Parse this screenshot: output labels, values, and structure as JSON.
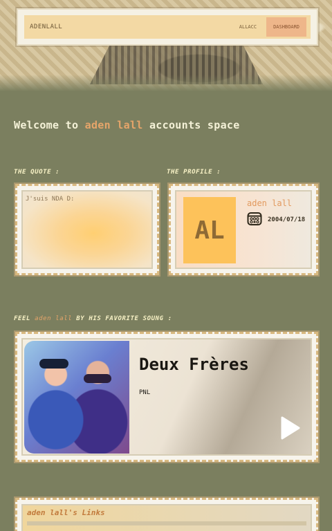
{
  "nav": {
    "brand": "ADENLALL",
    "links": [
      {
        "label": "ALLACC"
      },
      {
        "label": "DASHBOARD"
      }
    ]
  },
  "welcome": {
    "prefix": "Welcome to ",
    "name": "aden lall",
    "suffix": " accounts space"
  },
  "quote": {
    "label": "THE QUOTE :",
    "text": "J'suis NDA D:"
  },
  "profile": {
    "label": "THE PROFILE :",
    "initials": "AL",
    "name": "aden lall",
    "date": "2004/07/18",
    "date_icon": "calendar-icon"
  },
  "song": {
    "label_prefix": "FEEL ",
    "label_name": "aden lall",
    "label_suffix": " BY HIS FAVORITE SOUNG :",
    "title": "Deux Frères",
    "artist": "PNL",
    "play_icon": "play-icon"
  },
  "links": {
    "title": "aden lall's Links"
  },
  "colors": {
    "background": "#7b7f5f",
    "accent": "#e6a56a",
    "label": "#f8f2c6"
  }
}
